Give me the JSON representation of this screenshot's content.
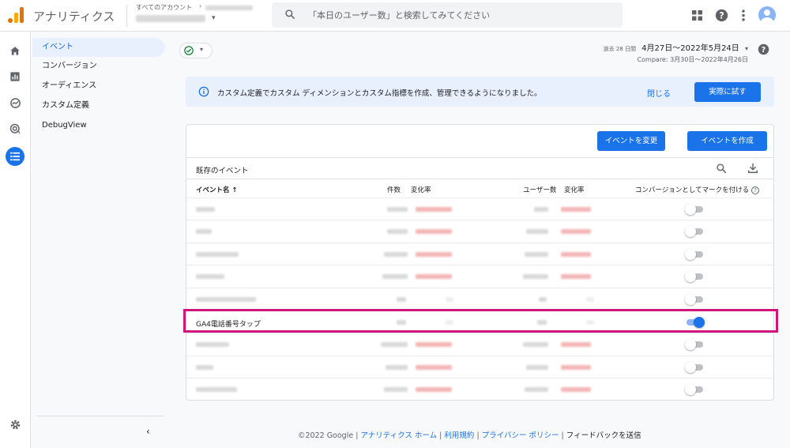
{
  "header": {
    "app_title": "アナリティクス",
    "account_label": "すべてのアカウント",
    "search_placeholder": "「本日のユーザー数」と検索してみてください"
  },
  "nav": {
    "items": [
      {
        "label": "イベント",
        "active": true
      },
      {
        "label": "コンバージョン",
        "active": false
      },
      {
        "label": "オーディエンス",
        "active": false
      },
      {
        "label": "カスタム定義",
        "active": false
      },
      {
        "label": "DebugView",
        "active": false
      }
    ]
  },
  "date_range": {
    "prefix": "過去 28 日間",
    "range": "4月27日〜2022年5月24日",
    "compare": "Compare: 3月30日〜2022年4月26日"
  },
  "banner": {
    "text": "カスタム定義でカスタム ディメンションとカスタム指標を作成、管理できるようになりました。",
    "close": "閉じる",
    "try": "実際に試す"
  },
  "table": {
    "modify_button": "イベントを変更",
    "create_button": "イベントを作成",
    "subtitle": "既存のイベント",
    "columns": {
      "name": "イベント名 ↑",
      "count": "件数",
      "change1": "変化率",
      "users": "ユーザー数",
      "change2": "変化率",
      "conversion": "コンバージョンとしてマークを付ける"
    },
    "rows": [
      {
        "name": "",
        "conversion": false
      },
      {
        "name": "",
        "conversion": false
      },
      {
        "name": "",
        "conversion": false
      },
      {
        "name": "",
        "conversion": false
      },
      {
        "name": "",
        "conversion": false
      },
      {
        "name": "GA4電話番号タップ",
        "conversion": true
      },
      {
        "name": "",
        "conversion": false
      },
      {
        "name": "",
        "conversion": false
      },
      {
        "name": "",
        "conversion": false
      }
    ]
  },
  "footer": {
    "copyright": "©2022 Google",
    "home": "アナリティクス ホーム",
    "terms": "利用規約",
    "privacy": "プライバシー ポリシー",
    "feedback": "フィードバックを送信"
  },
  "colors": {
    "accent": "#1a73e8",
    "highlight": "#d1157e",
    "banner_bg": "#e8f0fe"
  }
}
